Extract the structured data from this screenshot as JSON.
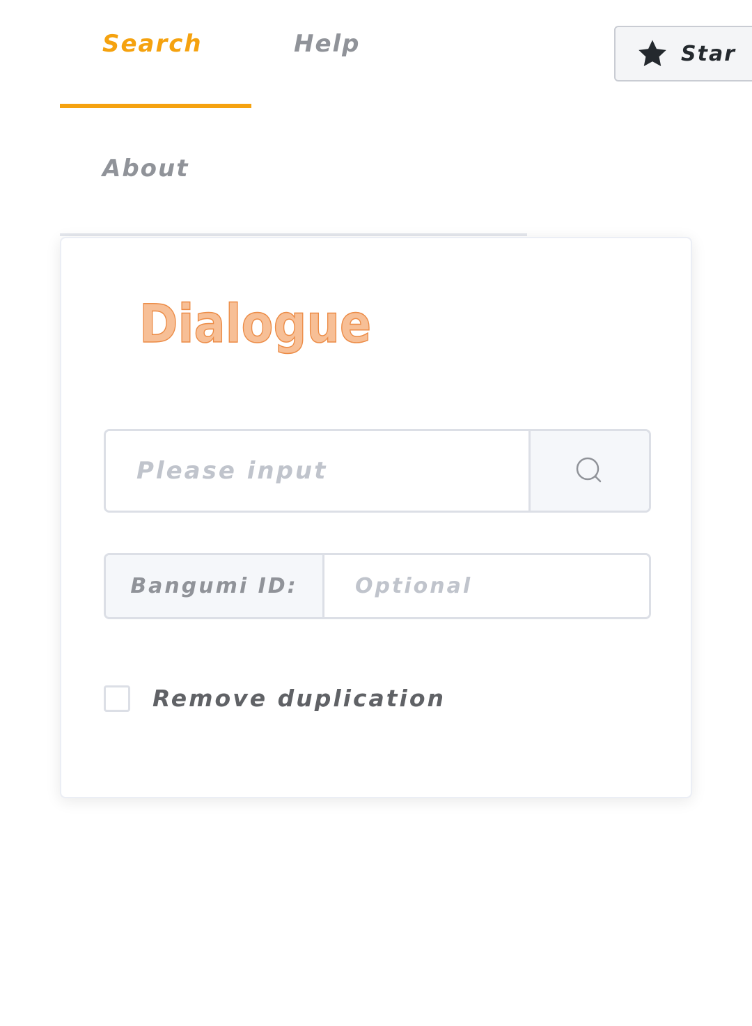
{
  "tabs": [
    {
      "label": "Search",
      "active": true
    },
    {
      "label": "Help",
      "active": false
    },
    {
      "label": "About",
      "active": false
    }
  ],
  "star_button": {
    "label": "Star",
    "icon": "star-icon"
  },
  "card": {
    "logo_text": "Dialogue",
    "search": {
      "placeholder": "Please input",
      "value": "",
      "button_icon": "search-icon"
    },
    "bangumi": {
      "prefix_label": "Bangumi ID:",
      "placeholder": "Optional",
      "value": ""
    },
    "remove_duplication": {
      "label": "Remove duplication",
      "checked": false
    }
  },
  "colors": {
    "accent": "#f5a20f",
    "tab_inactive": "#909399",
    "border": "#dcdfe6",
    "logo_fill": "#f7bf96",
    "logo_stroke": "#ec8b45"
  }
}
